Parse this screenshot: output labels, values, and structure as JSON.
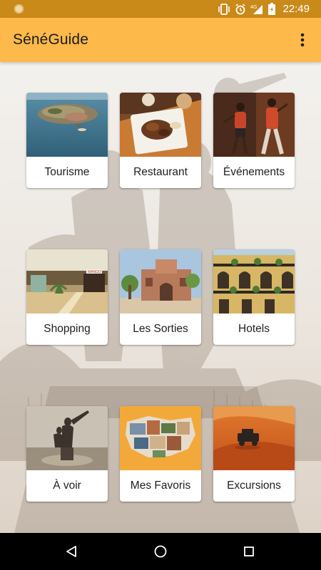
{
  "status_bar": {
    "time": "22:49",
    "network": "4G",
    "icons": [
      "notification-dot-icon",
      "vibrate-icon",
      "alarm-icon",
      "signal-icon",
      "battery-icon"
    ]
  },
  "app_bar": {
    "title": "SénéGuide",
    "menu_icon": "more-vert-icon"
  },
  "colors": {
    "status_bar": "#c98a1a",
    "app_bar": "#fdb94a",
    "nav_bar": "#000000"
  },
  "grid": {
    "tiles": [
      {
        "label": "Tourisme",
        "image": "island-photo"
      },
      {
        "label": "Restaurant",
        "image": "food-plate-photo"
      },
      {
        "label": "Événements",
        "image": "dancers-photo"
      },
      {
        "label": "Shopping",
        "image": "mall-photo"
      },
      {
        "label": "Les Sorties",
        "image": "building-photo"
      },
      {
        "label": "Hotels",
        "image": "hotel-balcony-photo"
      },
      {
        "label": "À voir",
        "image": "monument-photo"
      },
      {
        "label": "Mes Favoris",
        "image": "map-collage-photo"
      },
      {
        "label": "Excursions",
        "image": "desert-jeep-photo"
      }
    ]
  },
  "nav_bar": {
    "buttons": [
      "back-icon",
      "home-icon",
      "recents-icon"
    ]
  }
}
